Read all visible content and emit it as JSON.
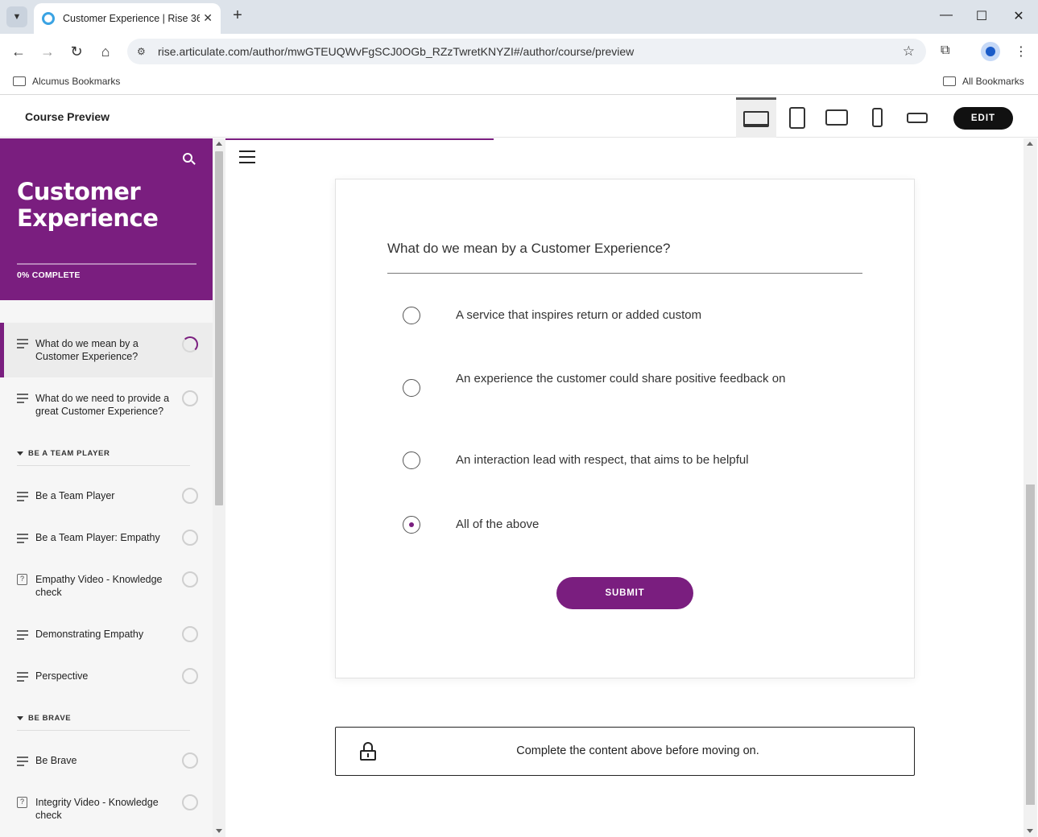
{
  "browser": {
    "tab_title": "Customer Experience | Rise 360",
    "url": "rise.articulate.com/author/mwGTEUQWvFgSCJ0OGb_RZzTwretKNYZI#/author/course/preview",
    "bookmark_left": "Alcumus Bookmarks",
    "bookmark_right": "All Bookmarks"
  },
  "preview_header": {
    "title": "Course Preview",
    "devices": [
      "laptop-icon",
      "tablet-icon",
      "tablet-landscape-icon",
      "phone-icon",
      "phone-landscape-icon"
    ],
    "active_device": "laptop",
    "edit_label": "EDIT"
  },
  "sidebar": {
    "course_title": "Customer Experience",
    "progress_label": "0% COMPLETE",
    "progress_fraction": 0,
    "items": [
      {
        "label": "What do we mean by a Customer Experience?",
        "type": "lesson",
        "status": "in-progress",
        "active": true
      },
      {
        "label": "What do we need to provide a great Customer Experience?",
        "type": "lesson",
        "status": "not-started"
      }
    ],
    "sections": [
      {
        "label": "BE A TEAM PLAYER",
        "items": [
          {
            "label": "Be a Team Player",
            "type": "lesson",
            "status": "not-started"
          },
          {
            "label": "Be a Team Player: Empathy",
            "type": "lesson",
            "status": "not-started"
          },
          {
            "label": "Empathy Video - Knowledge check",
            "type": "quiz",
            "status": "not-started"
          },
          {
            "label": "Demonstrating Empathy",
            "type": "lesson",
            "status": "not-started"
          },
          {
            "label": "Perspective",
            "type": "lesson",
            "status": "not-started"
          }
        ]
      },
      {
        "label": "BE BRAVE",
        "items": [
          {
            "label": "Be Brave",
            "type": "lesson",
            "status": "not-started"
          },
          {
            "label": "Integrity Video - Knowledge check",
            "type": "quiz",
            "status": "not-started"
          }
        ]
      }
    ]
  },
  "quiz": {
    "question": "What do we mean by a Customer Experience?",
    "answers": [
      {
        "text": "A service that inspires return or added custom",
        "selected": false
      },
      {
        "text": "An experience the customer could share positive feedback on",
        "selected": false
      },
      {
        "text": "An interaction lead with respect, that aims to be helpful",
        "selected": false
      },
      {
        "text": "All of the above",
        "selected": true
      }
    ],
    "submit_label": "SUBMIT"
  },
  "locked_notice": "Complete the content above before moving on.",
  "colors": {
    "brand": "#7a1e7f",
    "sidebar_bg": "#f6f6f6"
  }
}
